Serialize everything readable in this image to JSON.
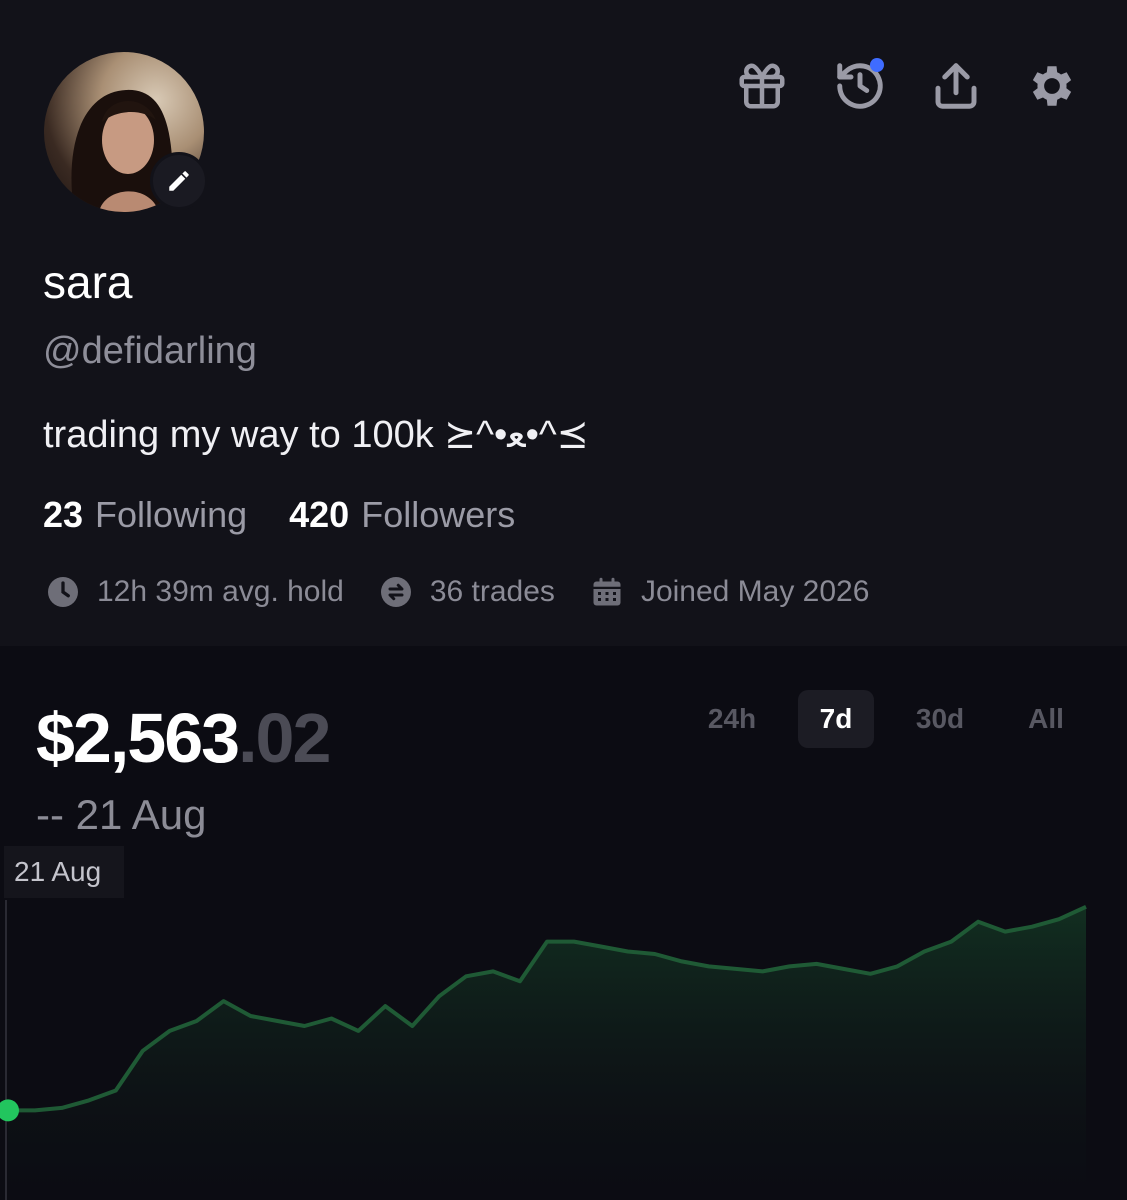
{
  "profile": {
    "name": "sara",
    "handle": "@defidarling",
    "bio": "trading my way to 100k ⪰^•ﻌ•^⪯",
    "following_count": "23",
    "following_label": "Following",
    "followers_count": "420",
    "followers_label": "Followers",
    "avg_hold": "12h 39m avg. hold",
    "trades": "36 trades",
    "joined": "Joined May 2026"
  },
  "header_icons": [
    "gift-icon",
    "history-icon",
    "share-icon",
    "settings-icon"
  ],
  "portfolio": {
    "balance_main": "$2,563",
    "balance_cents": ".02",
    "date_line": "-- 21 Aug",
    "tooltip_date": "21 Aug",
    "ranges": [
      "24h",
      "7d",
      "30d",
      "All"
    ],
    "active_range": "7d"
  },
  "colors": {
    "background": "#111118",
    "accent_line": "#1f5a35",
    "start_dot": "#22c55e",
    "notification_dot": "#3f6cff"
  },
  "chart_data": {
    "type": "area",
    "x": [
      0,
      1,
      2,
      3,
      4,
      5,
      6,
      7,
      8,
      9,
      10,
      11,
      12,
      13,
      14,
      15,
      16,
      17,
      18,
      19,
      20,
      21,
      22,
      23,
      24,
      25,
      26,
      27,
      28,
      29,
      30,
      31,
      32,
      33,
      34,
      35,
      36,
      37,
      38,
      39,
      40
    ],
    "values": [
      10,
      10,
      10.5,
      12,
      14,
      22,
      26,
      28,
      32,
      29,
      28,
      27,
      28.5,
      26,
      31,
      27,
      33,
      37,
      38,
      36,
      44,
      44,
      43,
      42,
      41.5,
      40,
      39,
      38.5,
      38,
      39,
      39.5,
      38.5,
      37.5,
      39,
      42,
      44,
      48,
      46,
      47,
      48.5,
      51
    ],
    "title": "",
    "xlabel": "",
    "ylabel": ""
  }
}
